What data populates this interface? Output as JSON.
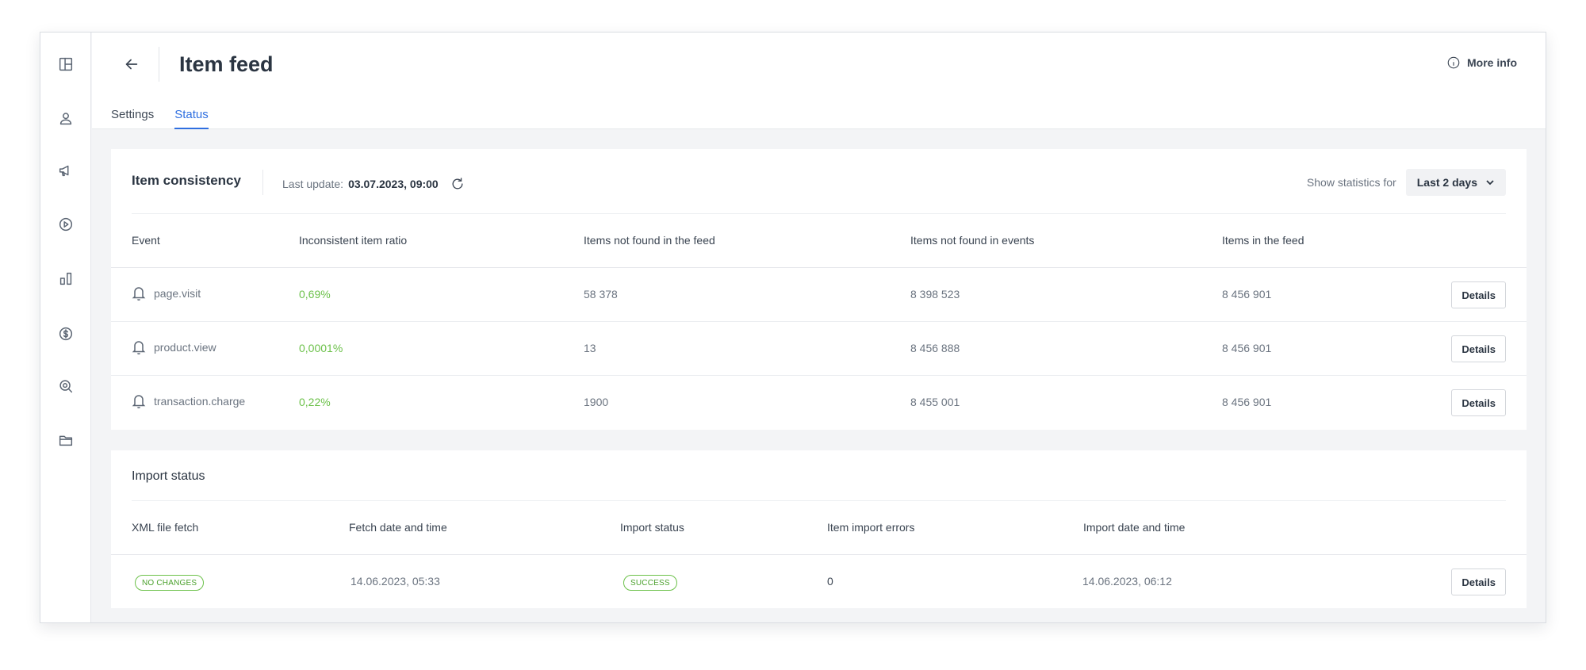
{
  "page": {
    "title": "Item feed",
    "more_info": "More info",
    "tabs": [
      {
        "label": "Settings",
        "active": false
      },
      {
        "label": "Status",
        "active": true
      }
    ]
  },
  "sidebar": {
    "icons": [
      "layout-icon",
      "user-icon",
      "megaphone-icon",
      "play-icon",
      "bar-chart-icon",
      "dollar-icon",
      "search-analytics-icon",
      "folder-icon"
    ]
  },
  "consistency": {
    "title": "Item consistency",
    "last_update_label": "Last update:",
    "last_update_value": "03.07.2023, 09:00",
    "stats_label": "Show statistics for",
    "stats_value": "Last 2 days",
    "columns": [
      "Event",
      "Inconsistent item ratio",
      "Items not found in the feed",
      "Items not found in events",
      "Items in the feed"
    ],
    "rows": [
      {
        "event": "page.visit",
        "ratio": "0,69%",
        "not_in_feed": "58 378",
        "not_in_events": "8 398 523",
        "in_feed": "8 456 901",
        "action": "Details"
      },
      {
        "event": "product.view",
        "ratio": "0,0001%",
        "not_in_feed": "13",
        "not_in_events": "8 456 888",
        "in_feed": "8 456 901",
        "action": "Details"
      },
      {
        "event": "transaction.charge",
        "ratio": "0,22%",
        "not_in_feed": "1900",
        "not_in_events": "8 455 001",
        "in_feed": "8 456 901",
        "action": "Details"
      }
    ]
  },
  "import": {
    "title": "Import status",
    "columns": [
      "XML file fetch",
      "Fetch date and time",
      "Import status",
      "Item import errors",
      "Import date and time"
    ],
    "rows": [
      {
        "fetch": "NO CHANGES",
        "fetch_date": "14.06.2023, 05:33",
        "status": "SUCCESS",
        "errors": "0",
        "import_date": "14.06.2023, 06:12",
        "action": "Details"
      }
    ]
  },
  "colors": {
    "accent": "#2f6fe0",
    "success": "#6cc14a"
  }
}
